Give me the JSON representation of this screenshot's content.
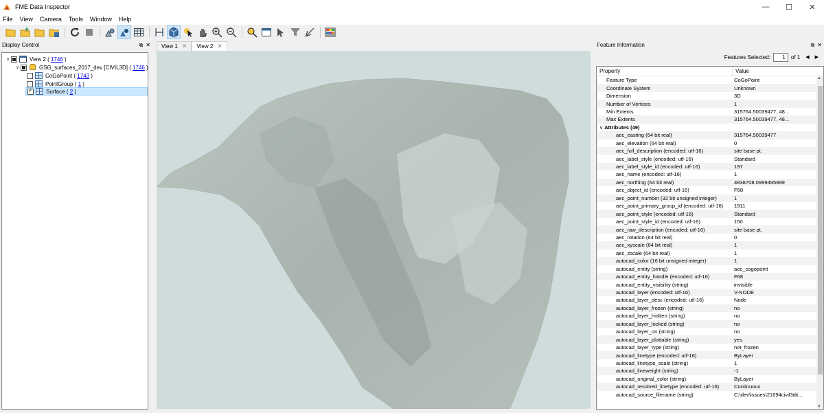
{
  "window": {
    "title": "FME Data Inspector"
  },
  "menu": [
    "File",
    "View",
    "Camera",
    "Tools",
    "Window",
    "Help"
  ],
  "display_control": {
    "title": "Display Control",
    "tree": [
      {
        "label": "View 2",
        "count": "1746",
        "level": 0
      },
      {
        "label": "GSG_surfaces_2017_dev [CIVIL3D]",
        "count": "1746",
        "level": 1
      },
      {
        "label": "CoGoPoint",
        "count": "1743",
        "level": 2
      },
      {
        "label": "PointGroup",
        "count": "1",
        "level": 2
      },
      {
        "label": "Surface",
        "count": "2",
        "level": 2
      }
    ]
  },
  "views": {
    "tabs": [
      "View 1",
      "View 2"
    ],
    "active": "View 2"
  },
  "feature_info": {
    "title": "Feature Information",
    "features_selected_label": "Features Selected:",
    "selected_value": "1",
    "of_label": "of 1",
    "columns": [
      "Property",
      "Value"
    ],
    "properties": [
      [
        "Feature Type",
        "CoGoPoint"
      ],
      [
        "Coordinate System",
        "Unknown"
      ],
      [
        "Dimension",
        "3D"
      ],
      [
        "Number of Vertices",
        "1"
      ],
      [
        "Min Extents",
        "315764.50039477, 48..."
      ],
      [
        "Max Extents",
        "315764.50039477, 48..."
      ]
    ],
    "attributes_label": "Attributes (49)",
    "attributes": [
      [
        "aec_easting (64 bit real)",
        "315764.50039477"
      ],
      [
        "aec_elevation (64 bit real)",
        "0"
      ],
      [
        "aec_full_description (encoded: utf-16)",
        "site base pt."
      ],
      [
        "aec_label_style (encoded: utf-16)",
        "Standard"
      ],
      [
        "aec_label_style_id (encoded: utf-16)",
        "197"
      ],
      [
        "aec_name (encoded: utf-16)",
        "1"
      ],
      [
        "aec_northing (64 bit real)",
        "4838708.0999495899"
      ],
      [
        "aec_object_id (encoded: utf-16)",
        "F68"
      ],
      [
        "aec_point_number (32 bit unsigned integer)",
        "1"
      ],
      [
        "aec_point_primary_group_id (encoded: utf-16)",
        "1911"
      ],
      [
        "aec_point_style (encoded: utf-16)",
        "Standard"
      ],
      [
        "aec_point_style_id (encoded: utf-16)",
        "150"
      ],
      [
        "aec_raw_description (encoded: utf-16)",
        "site base pt."
      ],
      [
        "aec_rotation (64 bit real)",
        "0"
      ],
      [
        "aec_xyscale (64 bit real)",
        "1"
      ],
      [
        "aec_zscale (64 bit real)",
        "1"
      ],
      [
        "autocad_color (16 bit unsigned integer)",
        "1"
      ],
      [
        "autocad_entity (string)",
        "aec_cogopoint"
      ],
      [
        "autocad_entity_handle (encoded: utf-16)",
        "F68"
      ],
      [
        "autocad_entity_visibility (string)",
        "invisible"
      ],
      [
        "autocad_layer (encoded: utf-16)",
        "V-NODE"
      ],
      [
        "autocad_layer_desc (encoded: utf-16)",
        "Node"
      ],
      [
        "autocad_layer_frozen (string)",
        "no"
      ],
      [
        "autocad_layer_hidden (string)",
        "no"
      ],
      [
        "autocad_layer_locked (string)",
        "no"
      ],
      [
        "autocad_layer_on (string)",
        "no"
      ],
      [
        "autocad_layer_plottable (string)",
        "yes"
      ],
      [
        "autocad_layer_type (string)",
        "not_frozen"
      ],
      [
        "autocad_linetype (encoded: utf-16)",
        "ByLayer"
      ],
      [
        "autocad_linetype_scale (string)",
        "1"
      ],
      [
        "autocad_lineweight (string)",
        "-1"
      ],
      [
        "autocad_original_color (string)",
        "ByLayer"
      ],
      [
        "autocad_resolved_linetype (encoded: utf-16)",
        "Continuous"
      ],
      [
        "autocad_source_filename (string)",
        "C:\\dev\\issues\\21694civil3dti..."
      ]
    ]
  }
}
